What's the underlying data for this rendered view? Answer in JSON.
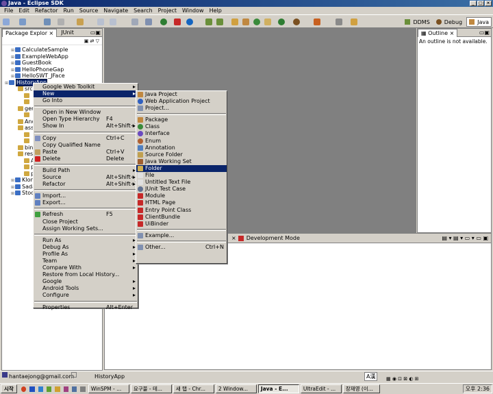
{
  "window": {
    "title": "Java - Eclipse SDK"
  },
  "menubar": [
    "File",
    "Edit",
    "Refactor",
    "Run",
    "Source",
    "Navigate",
    "Search",
    "Project",
    "Window",
    "Help"
  ],
  "perspectives": [
    {
      "label": "DDMS",
      "active": false
    },
    {
      "label": "Debug",
      "active": false
    },
    {
      "label": "Java",
      "active": true
    }
  ],
  "package_explorer": {
    "tab_label": "Package Explor",
    "tab2_label": "JUnit",
    "tree": [
      {
        "label": "CalculateSample",
        "indent": 1
      },
      {
        "label": "ExampleWebApp",
        "indent": 1
      },
      {
        "label": "GuestBook",
        "indent": 1
      },
      {
        "label": "HelloPhoneGap",
        "indent": 1
      },
      {
        "label": "HelloSWT_JFace",
        "indent": 1
      },
      {
        "label": "HistoryApp",
        "indent": 0,
        "selected": true
      },
      {
        "label": "src",
        "indent": 2
      },
      {
        "label": "",
        "indent": 3
      },
      {
        "label": "",
        "indent": 3
      },
      {
        "label": "ger",
        "indent": 2
      },
      {
        "label": "",
        "indent": 3
      },
      {
        "label": "And",
        "indent": 2
      },
      {
        "label": "ass",
        "indent": 2
      },
      {
        "label": "",
        "indent": 3
      },
      {
        "label": "",
        "indent": 3
      },
      {
        "label": "bin",
        "indent": 2
      },
      {
        "label": "res",
        "indent": 2
      },
      {
        "label": "And",
        "indent": 3
      },
      {
        "label": "pro",
        "indent": 3
      },
      {
        "label": "pro",
        "indent": 3
      },
      {
        "label": "KlonDi",
        "indent": 1
      },
      {
        "label": "Sadari",
        "indent": 1
      },
      {
        "label": "StockV",
        "indent": 1
      }
    ]
  },
  "outline": {
    "tab_label": "Outline",
    "message": "An outline is not available."
  },
  "bottom_panel": {
    "tab_label": "Development Mode"
  },
  "context_menu": [
    {
      "label": "Google Web Toolkit",
      "submenu": true
    },
    {
      "label": "New",
      "submenu": true,
      "highlight": true
    },
    {
      "label": "Go Into"
    },
    {
      "sep": true
    },
    {
      "label": "Open in New Window"
    },
    {
      "label": "Open Type Hierarchy",
      "shortcut": "F4"
    },
    {
      "label": "Show In",
      "shortcut": "Alt+Shift+W",
      "submenu": true
    },
    {
      "sep": true
    },
    {
      "label": "Copy",
      "shortcut": "Ctrl+C",
      "icon": "copy"
    },
    {
      "label": "Copy Qualified Name"
    },
    {
      "label": "Paste",
      "shortcut": "Ctrl+V",
      "icon": "paste"
    },
    {
      "label": "Delete",
      "shortcut": "Delete",
      "icon": "delete"
    },
    {
      "sep": true
    },
    {
      "label": "Build Path",
      "submenu": true
    },
    {
      "label": "Source",
      "shortcut": "Alt+Shift+S",
      "submenu": true
    },
    {
      "label": "Refactor",
      "shortcut": "Alt+Shift+T",
      "submenu": true
    },
    {
      "sep": true
    },
    {
      "label": "Import...",
      "icon": "import"
    },
    {
      "label": "Export...",
      "icon": "export"
    },
    {
      "sep": true
    },
    {
      "label": "Refresh",
      "shortcut": "F5",
      "icon": "refresh"
    },
    {
      "label": "Close Project"
    },
    {
      "label": "Assign Working Sets..."
    },
    {
      "sep": true
    },
    {
      "label": "Run As",
      "submenu": true
    },
    {
      "label": "Debug As",
      "submenu": true
    },
    {
      "label": "Profile As",
      "submenu": true
    },
    {
      "label": "Team",
      "submenu": true
    },
    {
      "label": "Compare With",
      "submenu": true
    },
    {
      "label": "Restore from Local History..."
    },
    {
      "label": "Google",
      "submenu": true
    },
    {
      "label": "Android Tools",
      "submenu": true
    },
    {
      "label": "Configure",
      "submenu": true
    },
    {
      "sep": true
    },
    {
      "label": "Properties",
      "shortcut": "Alt+Enter"
    }
  ],
  "new_submenu": [
    {
      "label": "Java Project",
      "icon": "java-project"
    },
    {
      "label": "Web Application Project",
      "icon": "gwt"
    },
    {
      "label": "Project...",
      "icon": "project"
    },
    {
      "sep": true
    },
    {
      "label": "Package",
      "icon": "package"
    },
    {
      "label": "Class",
      "icon": "class"
    },
    {
      "label": "Interface",
      "icon": "interface"
    },
    {
      "label": "Enum",
      "icon": "enum"
    },
    {
      "label": "Annotation",
      "icon": "annotation"
    },
    {
      "label": "Source Folder",
      "icon": "source-folder"
    },
    {
      "label": "Java Working Set",
      "icon": "working-set"
    },
    {
      "label": "Folder",
      "icon": "folder",
      "highlight": true
    },
    {
      "label": "File",
      "icon": "file"
    },
    {
      "label": "Untitled Text File",
      "icon": "text-file"
    },
    {
      "label": "JUnit Test Case",
      "icon": "junit"
    },
    {
      "label": "Module",
      "icon": "gwt-module"
    },
    {
      "label": "HTML Page",
      "icon": "gwt-html"
    },
    {
      "label": "Entry Point Class",
      "icon": "gwt-entry"
    },
    {
      "label": "ClientBundle",
      "icon": "gwt-bundle"
    },
    {
      "label": "UiBinder",
      "icon": "gwt-uibinder"
    },
    {
      "sep": true
    },
    {
      "label": "Example...",
      "icon": "example"
    },
    {
      "sep": true
    },
    {
      "label": "Other...",
      "shortcut": "Ctrl+N",
      "icon": "other"
    }
  ],
  "status": {
    "account": "hantaejong@gmail.com",
    "selection": "HistoryApp",
    "ime": "A漢"
  },
  "taskbar": {
    "start": "시작",
    "items": [
      {
        "label": "WinSPM - ...",
        "active": false
      },
      {
        "label": "요구불 - 테...",
        "active": false
      },
      {
        "label": "새 탭 - Chr...",
        "active": false
      },
      {
        "label": "2 Window...",
        "active": false
      },
      {
        "label": "Java - E...",
        "active": true
      },
      {
        "label": "UltraEdit - ...",
        "active": false
      },
      {
        "label": "장재영 (이...",
        "active": false
      }
    ],
    "clock": "오후 2:36"
  },
  "colors": {
    "selection": "#0a246a",
    "titlebar": "#0a246a",
    "project_icon": "#3b6ec4"
  }
}
